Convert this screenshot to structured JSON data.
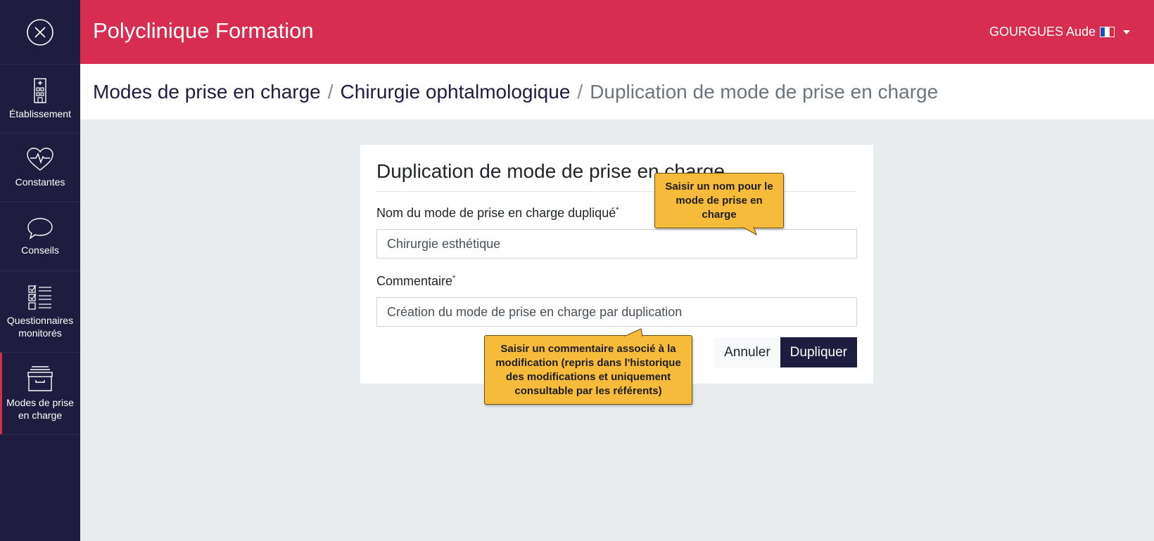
{
  "header": {
    "app_title": "Polyclinique Formation",
    "user_name": "GOURGUES Aude",
    "brand_color": "#d72d50"
  },
  "sidebar": {
    "color": "#1e1d3f",
    "items": [
      {
        "label": "Établissement",
        "icon": "building-icon"
      },
      {
        "label": "Constantes",
        "icon": "heart-pulse-icon"
      },
      {
        "label": "Conseils",
        "icon": "speech-bubble-icon"
      },
      {
        "label": "Questionnaires monitorés",
        "icon": "checklist-icon"
      },
      {
        "label": "Modes de prise en charge",
        "icon": "archive-box-icon",
        "active": true
      }
    ]
  },
  "breadcrumb": {
    "level1": "Modes de prise en charge",
    "level2": "Chirurgie ophtalmologique",
    "current": "Duplication de mode de prise en charge",
    "separator": "/"
  },
  "form": {
    "title": "Duplication de mode de prise en charge",
    "name_label": "Nom du mode de prise en charge dupliqué",
    "name_value": "Chirurgie esthétique",
    "comment_label": "Commentaire",
    "comment_value": "Création du mode de prise en charge par duplication",
    "required_mark": "*",
    "cancel_label": "Annuler",
    "submit_label": "Dupliquer"
  },
  "tooltips": {
    "name_tip": "Saisir un nom pour le mode de prise en charge",
    "comment_tip": "Saisir un commentaire associé à la modification (repris dans l'historique des modifications et uniquement consultable par les référents)",
    "color": "#f7bb3c"
  }
}
